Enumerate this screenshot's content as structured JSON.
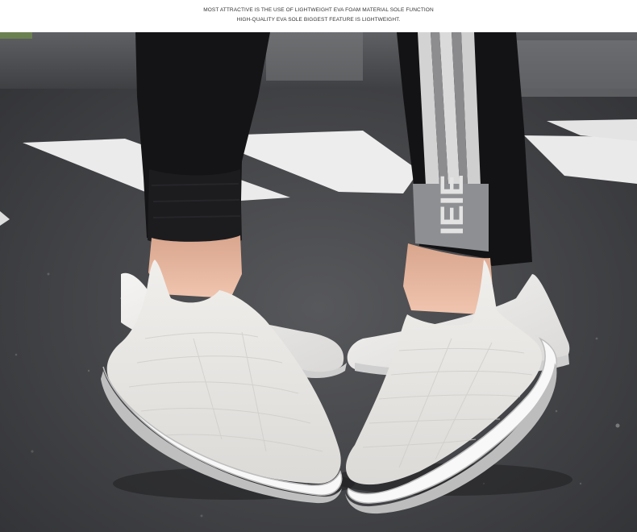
{
  "caption": {
    "line1": "MOST ATTRACTIVE IS THE USE OF LIGHTWEIGHT EVA FOAM MATERIAL SOLE FUNCTION",
    "line2": "HIGH-QUALITY EVA SOLE BIGGEST FEATURE IS LIGHTWEIGHT."
  },
  "photo": {
    "subject": "two pairs of legs in black jogger pants wearing white knit slip-on sneakers on asphalt",
    "cuff_print": "IEIE",
    "colors": {
      "asphalt": "#4a4b4e",
      "crosswalk": "#eeeeee",
      "pants": "#151517",
      "stripe": "#d8d8d8",
      "shoe": "#ecebe9",
      "sole": "#f7f7f7",
      "skin": "#e8b9a2"
    }
  }
}
